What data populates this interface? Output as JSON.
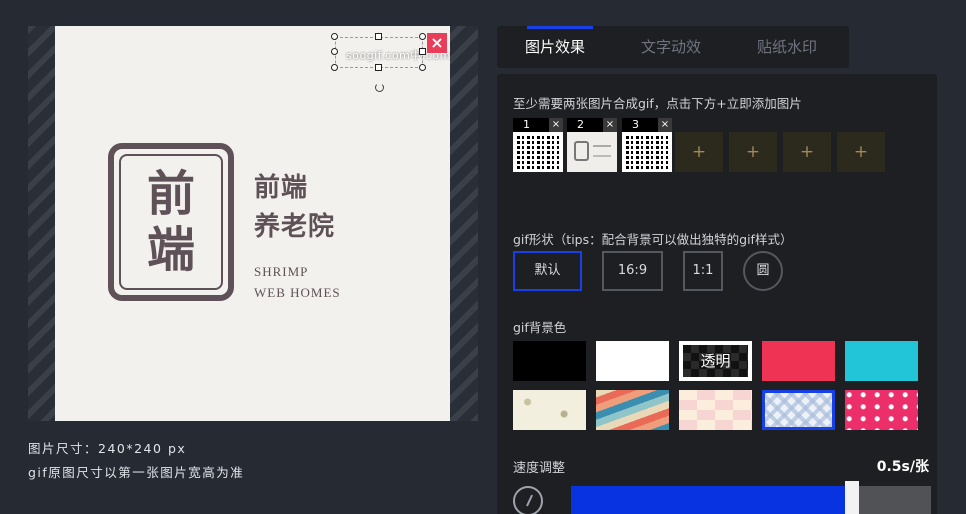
{
  "preview": {
    "seal_chars": [
      "前",
      "端"
    ],
    "brand_cn_line1": "前端",
    "brand_cn_line2": "养老院",
    "brand_en_line1": "SHRIMP",
    "brand_en_line2": "WEB HOMES",
    "watermark_text": "soogif.com中.com",
    "watermark_close": "×",
    "size_info": "图片尺寸：240*240 px",
    "size_note": "gif原图尺寸以第一张图片宽高为准"
  },
  "tabs": [
    {
      "label": "图片效果",
      "active": true
    },
    {
      "label": "文字动效",
      "active": false
    },
    {
      "label": "贴纸水印",
      "active": false
    }
  ],
  "images": {
    "hint": "至少需要两张图片合成gif，点击下方+立即添加图片",
    "thumbnails": [
      {
        "index": "1",
        "remove": "×",
        "kind": "qr-code"
      },
      {
        "index": "2",
        "remove": "×",
        "kind": "logo"
      },
      {
        "index": "3",
        "remove": "×",
        "kind": "qr-code"
      }
    ],
    "add_slots": [
      "+",
      "+",
      "+",
      "+"
    ]
  },
  "shape": {
    "label": "gif形状（tips：配合背景可以做出独特的gif样式）",
    "options": [
      {
        "label": "默认",
        "selected": true
      },
      {
        "label": "16:9",
        "selected": false
      },
      {
        "label": "1:1",
        "selected": false
      },
      {
        "label": "圆",
        "selected": false
      }
    ]
  },
  "background": {
    "label": "gif背景色",
    "transparent_label": "透明",
    "solid_colors": [
      "#000000",
      "#ffffff",
      "transparent",
      "#ee3354",
      "#22c4d8"
    ],
    "patterns": [
      "doodle",
      "retro-stripes",
      "pastel-tiles",
      "plaid",
      "pink-confetti"
    ],
    "selected_pattern": "plaid"
  },
  "speed": {
    "label": "速度调整",
    "value": "0.5s/张",
    "fill_fraction": 0.76
  },
  "colors": {
    "accent": "#1740e6",
    "panel": "#1e1f22",
    "page": "#262a33"
  }
}
